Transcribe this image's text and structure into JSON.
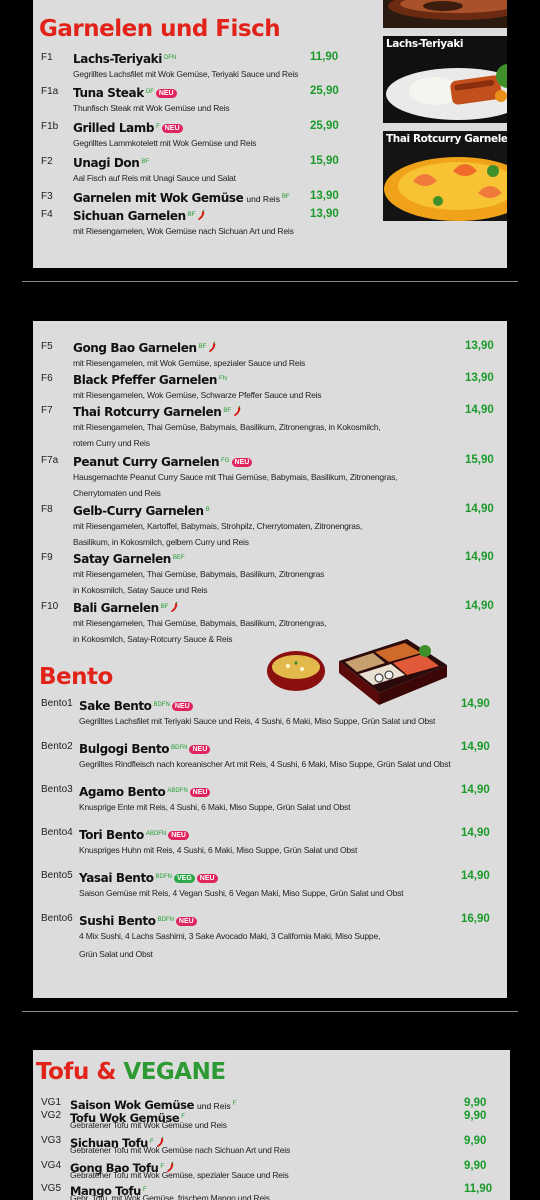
{
  "section1": {
    "title": "Garnelen und Fisch",
    "items": [
      {
        "code": "F1",
        "name": "Lachs-Teriyaki",
        "extra": "",
        "tags": "DFN",
        "neu": "",
        "chili": false,
        "price": "11,90",
        "desc": [
          "Gegrilltes Lachsfilet mit Wok Gemüse, Teriyaki Sauce und Reis"
        ]
      },
      {
        "code": "F1a",
        "name": "Tuna Steak",
        "extra": "",
        "tags": "DF",
        "neu": "NEU",
        "chili": false,
        "price": "25,90",
        "desc": [
          "Thunfisch Steak mit Wok Gemüse und Reis"
        ]
      },
      {
        "code": "F1b",
        "name": "Grilled Lamb",
        "extra": "",
        "tags": "F",
        "neu": "NEU",
        "chili": false,
        "price": "25,90",
        "desc": [
          "Gegrilltes Lammkotelett mit Wok Gemüse und Reis"
        ]
      },
      {
        "code": "F2",
        "name": "Unagi Don",
        "extra": "",
        "tags": "BF",
        "neu": "",
        "chili": false,
        "price": "15,90",
        "desc": [
          "Aal Fisch auf Reis mit Unagi Sauce und Salat"
        ]
      },
      {
        "code": "F3",
        "name": "Garnelen mit Wok Gemüse",
        "extra": "und Reis",
        "tags": "BF",
        "neu": "",
        "chili": false,
        "price": "13,90",
        "desc": []
      },
      {
        "code": "F4",
        "name": "Sichuan Garnelen",
        "extra": "",
        "tags": "BF",
        "neu": "",
        "chili": true,
        "price": "13,90",
        "desc": [
          "mit Riesengarnelen, Wok Gemüse nach Sichuan Art und Reis"
        ]
      }
    ],
    "photos": [
      {
        "caption": "",
        "label": "F2"
      },
      {
        "caption": "Lachs-Teriyaki",
        "label": "F1"
      },
      {
        "caption": "Thai Rotcurry Garnelen",
        "label": "F7"
      }
    ]
  },
  "section2": {
    "items": [
      {
        "code": "F5",
        "name": "Gong Bao Garnelen",
        "extra": "",
        "tags": "BF",
        "neu": "",
        "chili": true,
        "price": "13,90",
        "desc": [
          "mit Riesengarnelen, mit Wok Gemüse, spezialer Sauce und Reis"
        ]
      },
      {
        "code": "F6",
        "name": "Black Pfeffer Garnelen",
        "extra": "",
        "tags": "FN",
        "neu": "",
        "chili": false,
        "price": "13,90",
        "desc": [
          "mit Riesengarnelen, Wok Gemüse, Schwarze Pfeffer Sauce und Reis"
        ]
      },
      {
        "code": "F7",
        "name": "Thai Rotcurry Garnelen",
        "extra": "",
        "tags": "BF",
        "neu": "",
        "chili": true,
        "price": "14,90",
        "desc": [
          "mit Riesengarnelen, Thai Gemüse, Babymais, Basilikum,  Zitronengras, in Kokosmilch,",
          "rotem Curry und Reis"
        ]
      },
      {
        "code": "F7a",
        "name": "Peanut Curry Garnelen",
        "extra": "",
        "tags": "FG",
        "neu": "NEU",
        "chili": false,
        "price": "15,90",
        "desc": [
          "Hausgemachte Peanut Curry Sauce mit Thai Gemüse, Babymais, Basilikum, Zitronengras,",
          "Cherrytomaten und Reis"
        ]
      },
      {
        "code": "F8",
        "name": "Gelb-Curry Garnelen",
        "extra": "",
        "tags": "B",
        "neu": "",
        "chili": false,
        "price": "14,90",
        "desc": [
          "mit Riesengarnelen, Kartoffel, Babymais, Strohpilz, Cherrytomaten, Zitronengras,",
          "Basilikum, in Kokosmilch, gelbem Curry und Reis"
        ]
      },
      {
        "code": "F9",
        "name": "Satay Garnelen",
        "extra": "",
        "tags": "BEF",
        "neu": "",
        "chili": false,
        "price": "14,90",
        "desc": [
          "mit Riesengarnelen, Thai Gemüse, Babymais, Basilikum, Zitronengras",
          "in Kokosmilch, Satay Sauce und Reis"
        ]
      },
      {
        "code": "F10",
        "name": "Bali Garnelen",
        "extra": "",
        "tags": "BF",
        "neu": "",
        "chili": true,
        "price": "14,90",
        "desc": [
          "mit Riesengarnelen, Thai Gemüse, Babymais, Basilikum, Zitronengras,",
          "in Kokosmilch, Satay-Rotcurry Sauce & Reis"
        ]
      }
    ]
  },
  "bento": {
    "title": "Bento",
    "items": [
      {
        "code": "Bento1",
        "name": "Sake Bento",
        "tags": "BDFN",
        "veg": "",
        "neu": "NEU",
        "price": "14,90",
        "desc": [
          "Gegrilltes Lachsfilet mit Teriyaki Sauce und Reis, 4 Sushi, 6 Maki, Miso Suppe, Grün Salat und Obst"
        ]
      },
      {
        "code": "Bento2",
        "name": "Bulgogi Bento",
        "tags": "BDFN",
        "veg": "",
        "neu": "NEU",
        "price": "14,90",
        "desc": [
          "Gegrilltes Rindfleisch nach koreanischer Art mit Reis, 4 Sushi, 6 Maki, Miso Suppe, Grün Salat und Obst"
        ]
      },
      {
        "code": "Bento3",
        "name": "Agamo Bento",
        "tags": "ABDFN",
        "veg": "",
        "neu": "NEU",
        "price": "14,90",
        "desc": [
          "Knusprige Ente mit Reis, 4 Sushi, 6 Maki, Miso Suppe, Grün Salat und Obst"
        ]
      },
      {
        "code": "Bento4",
        "name": "Tori Bento",
        "tags": "ABDFN",
        "veg": "",
        "neu": "NEU",
        "price": "14,90",
        "desc": [
          "Knuspriges Huhn mit Reis, 4 Sushi, 6 Maki, Miso Suppe, Grün Salat und Obst"
        ]
      },
      {
        "code": "Bento5",
        "name": "Yasai Bento",
        "tags": "BDFN",
        "veg": "VEG",
        "neu": "NEU",
        "price": "14,90",
        "desc": [
          "Saison Gemüse mit Reis, 4 Vegan Sushi, 6 Vegan Maki, Miso Suppe, Grün Salat und Obst"
        ]
      },
      {
        "code": "Bento6",
        "name": "Sushi Bento",
        "tags": "BDFN",
        "veg": "",
        "neu": "NEU",
        "price": "16,90",
        "desc": [
          "4 Mix Sushi, 4 Lachs Sashimi, 3 Sake Avocado Maki, 3 California Maki, Miso Suppe,",
          "Grün Salat und Obst"
        ]
      }
    ]
  },
  "tofu": {
    "title_red": "Tofu &",
    "title_green": "VEGANE",
    "items": [
      {
        "code": "VG1",
        "name": "Saison Wok Gemüse",
        "extra": "und Reis",
        "tags": "F",
        "chili": false,
        "price": "9,90",
        "desc": ""
      },
      {
        "code": "VG2",
        "name": "Tofu Wok Gemüse",
        "extra": "",
        "tags": "F",
        "chili": false,
        "price": "9,90",
        "desc": "Gebratener Tofu mit Wok Gemüse und Reis"
      },
      {
        "code": "VG3",
        "name": "Sichuan Tofu",
        "extra": "",
        "tags": "F",
        "chili": true,
        "price": "9,90",
        "desc": "Gebratener Tofu mit Wok Gemüse nach Sichuan Art und Reis"
      },
      {
        "code": "VG4",
        "name": "Gong Bao Tofu",
        "extra": "",
        "tags": "F",
        "chili": true,
        "price": "9,90",
        "desc": "Gebratener Tofu mit Wok Gemüse, spezialer Sauce und Reis"
      },
      {
        "code": "VG5",
        "name": "Mango Tofu",
        "extra": "",
        "tags": "F",
        "chili": false,
        "price": "11,90",
        "desc": "Gebr. Tofu, mit Wok Gemüse, frischem Mango und Reis"
      }
    ]
  },
  "colors": {
    "title_red": "#e2231a",
    "price_green": "#1a9a2a",
    "neu_pink": "#e0245e",
    "panel": "#dcdcdc",
    "background": "#000000"
  }
}
